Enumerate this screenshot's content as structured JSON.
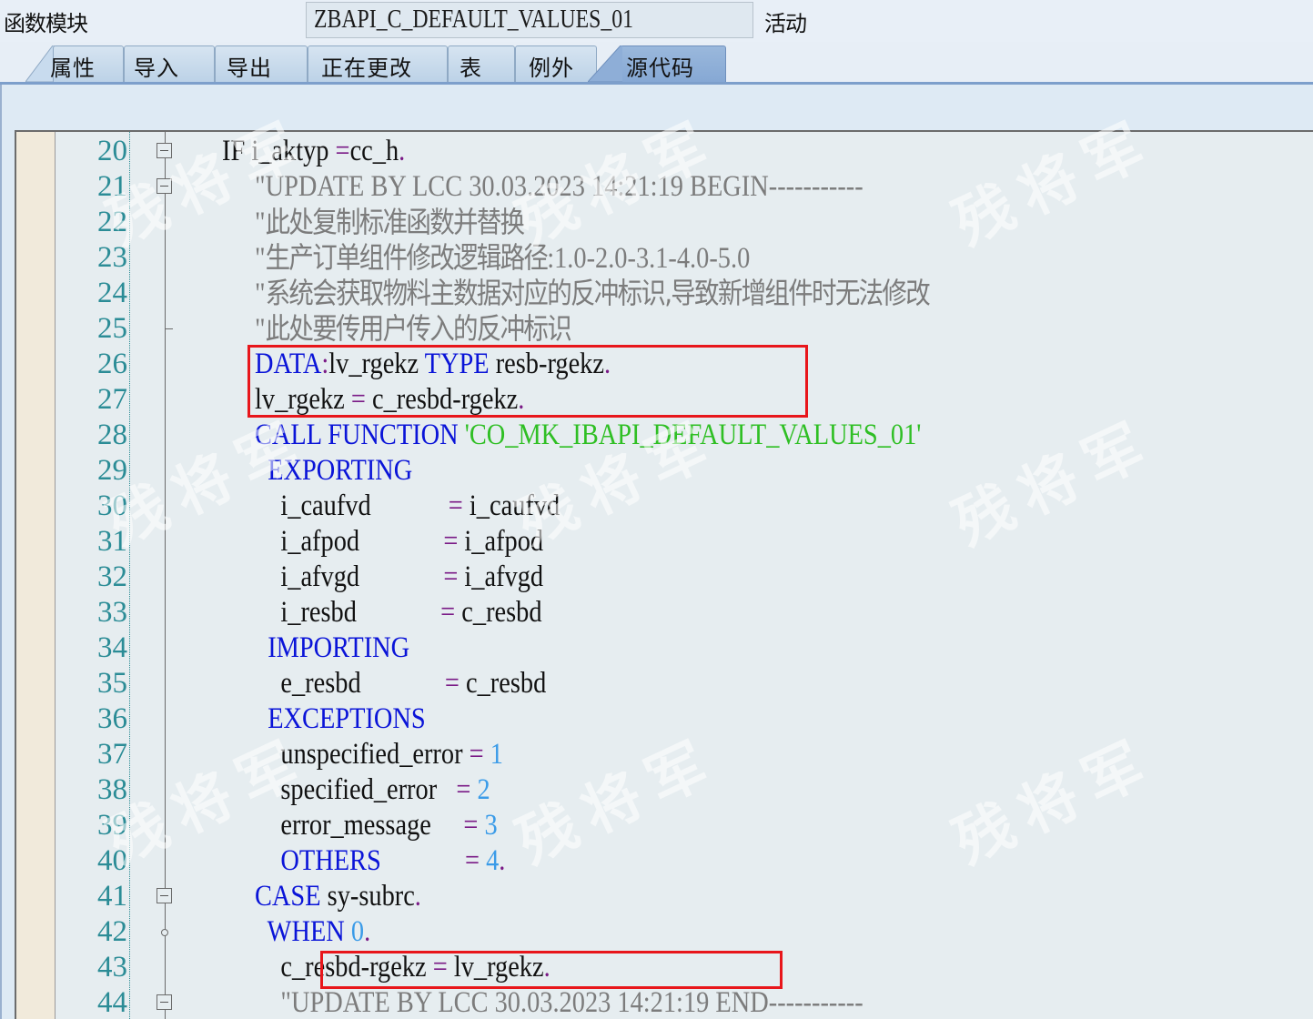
{
  "header": {
    "label": "函数模块",
    "function_name": "ZBAPI_C_DEFAULT_VALUES_01",
    "status": "活动"
  },
  "tabs": [
    {
      "label": "属性",
      "active": false
    },
    {
      "label": "导入",
      "active": false
    },
    {
      "label": "导出",
      "active": false
    },
    {
      "label": "正在更改",
      "active": false
    },
    {
      "label": "表",
      "active": false
    },
    {
      "label": "例外",
      "active": false
    },
    {
      "label": "源代码",
      "active": true
    }
  ],
  "watermark": "残将军",
  "colors": {
    "keyword": "#0a14d8",
    "comment": "#7c7c7c",
    "string": "#2fbf24",
    "operator": "#7a1a86",
    "number": "#3a9be8",
    "line_number": "#2b8c96",
    "highlight_box": "#e8161b",
    "active_tab": "#8aaad5"
  },
  "code_lines": [
    {
      "n": "20",
      "fold": "box",
      "tokens": [
        [
          "kw-plain",
          "IF i_aktyp "
        ],
        [
          "op",
          "="
        ],
        [
          "",
          "cc_h"
        ],
        [
          "op",
          "."
        ]
      ]
    },
    {
      "n": "21",
      "fold": "box",
      "tokens": [
        [
          "cm",
          "\"UPDATE BY LCC 30.03.2023 14:21:19 BEGIN-----------"
        ]
      ]
    },
    {
      "n": "22",
      "fold": "",
      "tokens": [
        [
          "cm",
          "\""
        ],
        [
          "cmcn",
          "此处复制标准函数并替换"
        ]
      ]
    },
    {
      "n": "23",
      "fold": "",
      "tokens": [
        [
          "cm",
          "\""
        ],
        [
          "cmcn",
          "生产订单组件修改逻辑路径"
        ],
        [
          "cm",
          ":1.0-2.0-3.1-4.0-5.0"
        ]
      ]
    },
    {
      "n": "24",
      "fold": "",
      "tokens": [
        [
          "cm",
          "\""
        ],
        [
          "cmcn",
          "系统会获取物料主数据对应的反冲标识,导致新增组件时无法修改"
        ]
      ]
    },
    {
      "n": "25",
      "fold": "end",
      "tokens": [
        [
          "cm",
          "\""
        ],
        [
          "cmcn",
          "此处要传用户传入的反冲标识"
        ]
      ]
    },
    {
      "n": "26",
      "fold": "",
      "tokens": [
        [
          "kw",
          "DATA"
        ],
        [
          "op",
          ":"
        ],
        [
          "",
          "lv_rgekz "
        ],
        [
          "kw",
          "TYPE"
        ],
        [
          "",
          " resb-rgekz"
        ],
        [
          "op",
          "."
        ]
      ]
    },
    {
      "n": "27",
      "fold": "",
      "tokens": [
        [
          "",
          "lv_rgekz "
        ],
        [
          "op",
          "="
        ],
        [
          "",
          " c_resbd-rgekz"
        ],
        [
          "op",
          "."
        ]
      ]
    },
    {
      "n": "28",
      "fold": "",
      "tokens": [
        [
          "kw",
          "CALL FUNCTION "
        ],
        [
          "str",
          "'CO_MK_IBAPI_DEFAULT_VALUES_01'"
        ]
      ]
    },
    {
      "n": "29",
      "fold": "",
      "tokens": [
        [
          "kw",
          "  EXPORTING"
        ]
      ]
    },
    {
      "n": "30",
      "fold": "",
      "tokens": [
        [
          "",
          "    i_caufvd            "
        ],
        [
          "op",
          "="
        ],
        [
          "",
          " i_caufvd"
        ]
      ]
    },
    {
      "n": "31",
      "fold": "",
      "tokens": [
        [
          "",
          "    i_afpod             "
        ],
        [
          "op",
          "="
        ],
        [
          "",
          " i_afpod"
        ]
      ]
    },
    {
      "n": "32",
      "fold": "",
      "tokens": [
        [
          "",
          "    i_afvgd             "
        ],
        [
          "op",
          "="
        ],
        [
          "",
          " i_afvgd"
        ]
      ]
    },
    {
      "n": "33",
      "fold": "",
      "tokens": [
        [
          "",
          "    i_resbd             "
        ],
        [
          "op",
          "="
        ],
        [
          "",
          " c_resbd"
        ]
      ]
    },
    {
      "n": "34",
      "fold": "",
      "tokens": [
        [
          "kw",
          "  IMPORTING"
        ]
      ]
    },
    {
      "n": "35",
      "fold": "",
      "tokens": [
        [
          "",
          "    e_resbd             "
        ],
        [
          "op",
          "="
        ],
        [
          "",
          " c_resbd"
        ]
      ]
    },
    {
      "n": "36",
      "fold": "",
      "tokens": [
        [
          "kw",
          "  EXCEPTIONS"
        ]
      ]
    },
    {
      "n": "37",
      "fold": "",
      "tokens": [
        [
          "",
          "    unspecified_error "
        ],
        [
          "op",
          "="
        ],
        [
          "num",
          " 1"
        ]
      ]
    },
    {
      "n": "38",
      "fold": "",
      "tokens": [
        [
          "",
          "    specified_error   "
        ],
        [
          "op",
          "="
        ],
        [
          "num",
          " 2"
        ]
      ]
    },
    {
      "n": "39",
      "fold": "",
      "tokens": [
        [
          "",
          "    error_message     "
        ],
        [
          "op",
          "="
        ],
        [
          "num",
          " 3"
        ]
      ]
    },
    {
      "n": "40",
      "fold": "",
      "tokens": [
        [
          "kw",
          "    OTHERS"
        ],
        [
          "",
          "             "
        ],
        [
          "op",
          "="
        ],
        [
          "num",
          " 4"
        ],
        [
          "op",
          "."
        ]
      ]
    },
    {
      "n": "41",
      "fold": "box",
      "tokens": [
        [
          "kw",
          "CASE"
        ],
        [
          "",
          " sy-subrc"
        ],
        [
          "op",
          "."
        ]
      ]
    },
    {
      "n": "42",
      "fold": "dot",
      "tokens": [
        [
          "kw",
          "  WHEN"
        ],
        [
          "num",
          " 0"
        ],
        [
          "op",
          "."
        ]
      ]
    },
    {
      "n": "43",
      "fold": "",
      "tokens": [
        [
          "",
          "    c_resbd-rgekz "
        ],
        [
          "op",
          "="
        ],
        [
          "",
          " lv_rgekz"
        ],
        [
          "op",
          "."
        ]
      ]
    },
    {
      "n": "44",
      "fold": "box",
      "tokens": [
        [
          "cm",
          "    \"UPDATE BY LCC 30.03.2023 14:21:19 END-----------"
        ]
      ]
    }
  ]
}
